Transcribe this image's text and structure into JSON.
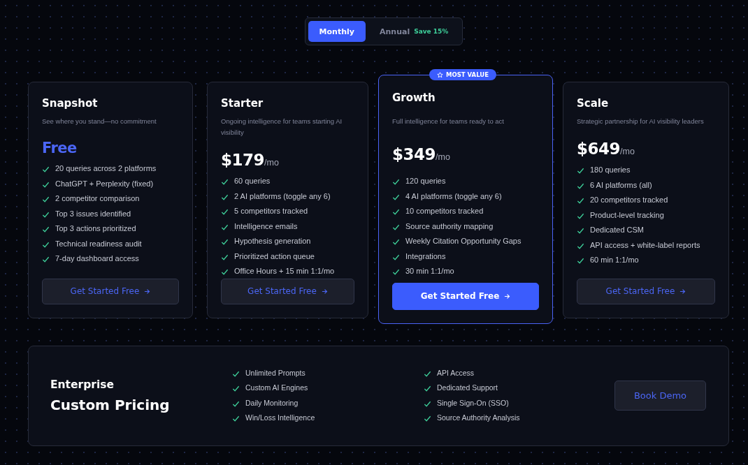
{
  "billing_toggle": [
    {
      "label": "Monthly",
      "selected": true
    },
    {
      "label": "Annual",
      "selected": false,
      "badge": "Save 15%"
    }
  ],
  "plans": [
    {
      "name": "Snapshot",
      "description": "See where you stand—no commitment",
      "price": "Free",
      "featured": false,
      "features": [
        "20 queries across 2 platforms",
        "ChatGPT + Perplexity (fixed)",
        "2 competitor comparison",
        "Top 3 issues identified",
        "Top 3 actions prioritized",
        "Technical readiness audit",
        "7-day dashboard access"
      ],
      "button": "Get Started Free"
    },
    {
      "name": "Starter",
      "description": "Ongoing intelligence for teams starting AI visibility",
      "price": "$179",
      "period": "/mo",
      "featured": false,
      "features": [
        "60 queries",
        "2 AI platforms (toggle any 6)",
        "5 competitors tracked",
        "Intelligence emails",
        "Hypothesis generation",
        "Prioritized action queue",
        "Office Hours + 15 min 1:1/mo"
      ],
      "button": "Get Started Free"
    },
    {
      "name": "Growth",
      "badge": "MOST VALUE",
      "description": "Full intelligence for teams ready to act",
      "price": "$349",
      "period": "/mo",
      "featured": true,
      "features": [
        "120 queries",
        "4 AI platforms (toggle any 6)",
        "10 competitors tracked",
        "Source authority mapping",
        "Weekly Citation Opportunity Gaps",
        "Integrations",
        "30 min 1:1/mo"
      ],
      "button": "Get Started Free"
    },
    {
      "name": "Scale",
      "description": "Strategic partnership for AI visibility leaders",
      "price": "$649",
      "period": "/mo",
      "featured": false,
      "features": [
        "180 queries",
        "6 AI platforms (all)",
        "20 competitors tracked",
        "Product-level tracking",
        "Dedicated CSM",
        "API access + white-label reports",
        "60 min 1:1/mo"
      ],
      "button": "Get Started Free"
    }
  ],
  "enterprise": {
    "label": "Enterprise",
    "title": "Custom Pricing",
    "features_left": [
      "Unlimited Prompts",
      "Custom AI Engines",
      "Daily Monitoring",
      "Win/Loss Intelligence"
    ],
    "features_right": [
      "API Access",
      "Dedicated Support",
      "Single Sign-On (SSO)",
      "Source Authority Analysis"
    ],
    "button": "Book Demo"
  }
}
